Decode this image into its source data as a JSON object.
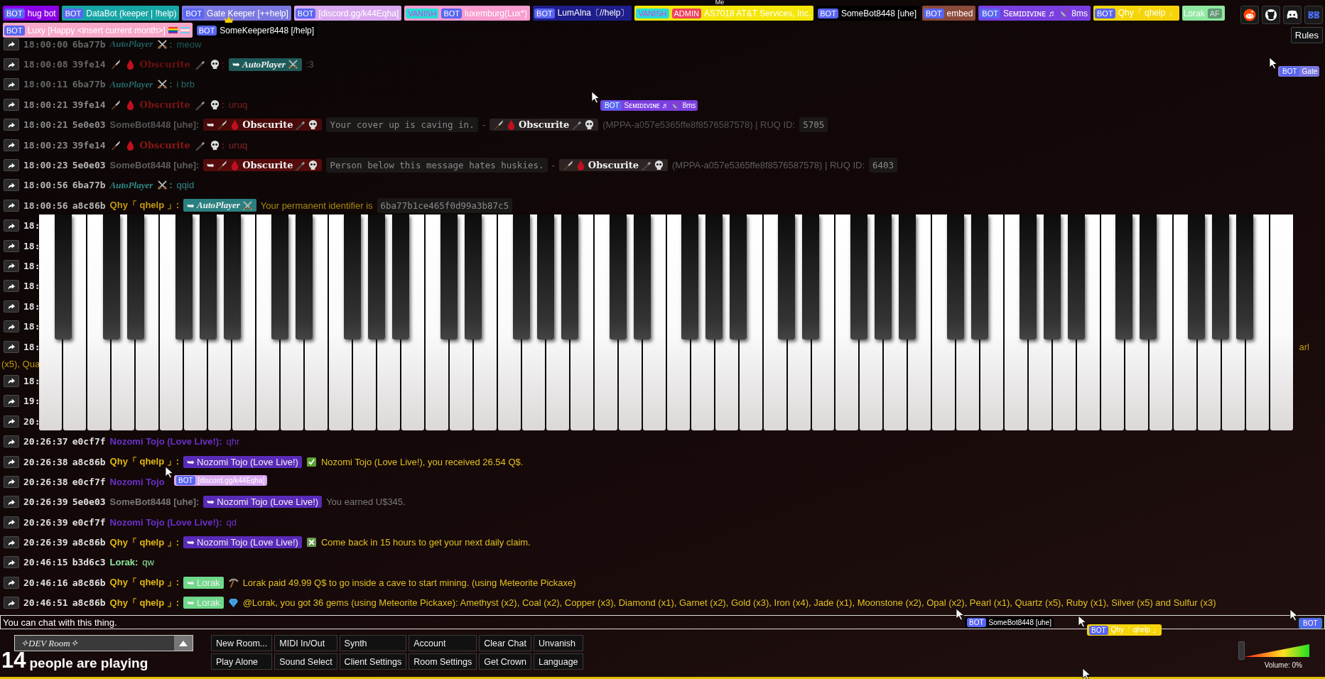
{
  "top_bar": {
    "users": [
      {
        "kind": "plain",
        "labels": [
          {
            "kind": "bot",
            "text": "BOT"
          }
        ],
        "name": "hug bot",
        "color": "#8a00e6"
      },
      {
        "kind": "plain",
        "labels": [
          {
            "kind": "bot",
            "text": "BOT"
          }
        ],
        "name": "DataBot (keeper | !help)",
        "color": "#17a5a5"
      },
      {
        "kind": "plain",
        "labels": [
          {
            "kind": "bot",
            "text": "BOT"
          }
        ],
        "name": "Gate Keeper [++help]",
        "color": "#7a78e0"
      },
      {
        "kind": "plain",
        "labels": [
          {
            "kind": "bot",
            "text": "BOT"
          }
        ],
        "name": "[discord.gg/k44Eqha]",
        "color": "#d9a8f0"
      },
      {
        "kind": "plain",
        "labels": [
          {
            "kind": "vanish",
            "text": "VANISH"
          },
          {
            "kind": "bot",
            "text": "BOT"
          }
        ],
        "name": "luxemburg(Lux*)",
        "color": "#f99ccf"
      },
      {
        "kind": "plain",
        "labels": [
          {
            "kind": "bot",
            "text": "BOT"
          }
        ],
        "name": "LumAlna〔//help〕",
        "color": "#1e1e8c"
      },
      {
        "kind": "plain",
        "labels": [
          {
            "kind": "vanish",
            "text": "VANISH"
          },
          {
            "kind": "admin",
            "text": "ADMIN"
          }
        ],
        "name": "AS7018 AT&T Services, Inc.",
        "color": "#f5e60a",
        "self_label": "Me"
      },
      {
        "kind": "plain",
        "labels": [
          {
            "kind": "bot",
            "text": "BOT"
          }
        ],
        "name": "SomeBot8448 [uhe]",
        "color": "#000000"
      },
      {
        "kind": "plain",
        "labels": [
          {
            "kind": "bot",
            "text": "BOT"
          }
        ],
        "name": "embed",
        "color": "#8b4a3a"
      },
      {
        "kind": "ping",
        "labels": [
          {
            "kind": "bot",
            "text": "BOT"
          }
        ],
        "name": "Sᴇᴍɪᴅɪᴠɪɴᴇ ♬",
        "suffix": "8ms",
        "color": "#7b3fe0"
      },
      {
        "kind": "plain",
        "labels": [
          {
            "kind": "bot",
            "text": "BOT"
          }
        ],
        "name": "Qhy「 qhelp 」",
        "color": "#f5d50a"
      },
      {
        "kind": "plain",
        "name": "Lorak",
        "labels_after": [
          {
            "kind": "afk",
            "text": "AF"
          }
        ],
        "color": "#8ee8a0"
      }
    ],
    "more_users": [
      {
        "kind": "flagged",
        "labels": [
          {
            "kind": "bot",
            "text": "BOT"
          }
        ],
        "name": "Luxy [Happy <insert current month>]",
        "color": "#f7a8c8"
      },
      {
        "kind": "plain",
        "labels": [
          {
            "kind": "bot",
            "text": "BOT"
          }
        ],
        "name": "SomeKeeper8448 [/help]",
        "color": "#000000",
        "owner": true
      }
    ],
    "rules_button": "Rules"
  },
  "chat": [
    {
      "time": "18:00:00",
      "id": "6ba77b",
      "parts": [
        {
          "kind": "script_name",
          "text": "AutoPlayer",
          "color": "#1f5e5e"
        },
        {
          "kind": "punct",
          "text": ":"
        },
        {
          "kind": "text",
          "text": "meow",
          "color": "#1f5e5e"
        }
      ]
    },
    {
      "time": "18:00:08",
      "id": "39fe14",
      "parts": [
        {
          "kind": "gothic_name",
          "text": "Obscurite",
          "color": "#6a1010"
        },
        {
          "kind": "punct",
          "text": ":"
        },
        {
          "kind": "script_tag",
          "arrow": "➥",
          "text": "AutoPlayer",
          "color": "#1e5a5a"
        },
        {
          "kind": "text",
          "text": ":3",
          "color": "#555555"
        }
      ]
    },
    {
      "time": "18:00:11",
      "id": "6ba77b",
      "parts": [
        {
          "kind": "script_name",
          "text": "AutoPlayer",
          "color": "#256b6b"
        },
        {
          "kind": "punct",
          "text": ":"
        },
        {
          "kind": "text",
          "text": "i brb",
          "color": "#256b6b"
        }
      ]
    },
    {
      "time": "18:00:21",
      "id": "39fe14",
      "parts": [
        {
          "kind": "gothic_name",
          "text": "Obscurite",
          "color": "#7a1414"
        },
        {
          "kind": "punct",
          "text": ":"
        },
        {
          "kind": "text",
          "text": "uruq",
          "color": "#7a2020"
        }
      ]
    },
    {
      "time": "18:00:21",
      "id": "5e0e03",
      "parts": [
        {
          "kind": "name",
          "text": "SomeBot8448 [uhe]:",
          "color": "#555555"
        },
        {
          "kind": "gothic_tag",
          "arrow": "➥",
          "text": "Obscurite",
          "color": "#4a0a0a"
        },
        {
          "kind": "code",
          "text": "Your cover up is caving in."
        },
        {
          "kind": "text",
          "text": "-"
        },
        {
          "kind": "gothic_tag",
          "text": "Obscurite",
          "color": "#2a2222"
        },
        {
          "kind": "text",
          "text": "(MPPA-a057e5365ffe8f8576587578) | RUQ ID:",
          "color": "#555555"
        },
        {
          "kind": "code",
          "text": "5705"
        }
      ]
    },
    {
      "time": "18:00:23",
      "id": "39fe14",
      "parts": [
        {
          "kind": "gothic_name",
          "text": "Obscurite",
          "color": "#8a1616"
        },
        {
          "kind": "punct",
          "text": ":"
        },
        {
          "kind": "text",
          "text": "uruq",
          "color": "#8a2424"
        }
      ]
    },
    {
      "time": "18:00:23",
      "id": "5e0e03",
      "parts": [
        {
          "kind": "name",
          "text": "SomeBot8448 [uhe]:",
          "color": "#5e5e5e"
        },
        {
          "kind": "gothic_tag",
          "arrow": "➥",
          "text": "Obscurite",
          "color": "#550b0b"
        },
        {
          "kind": "code",
          "text": "Person below this message hates huskies."
        },
        {
          "kind": "text",
          "text": "-"
        },
        {
          "kind": "gothic_tag",
          "text": "Obscurite",
          "color": "#2e2424"
        },
        {
          "kind": "text",
          "text": "(MPPA-a057e5365ffe8f8576587578) | RUQ ID:",
          "color": "#5e5e5e"
        },
        {
          "kind": "code",
          "text": "6403"
        }
      ]
    },
    {
      "time": "18:00:56",
      "id": "6ba77b",
      "parts": [
        {
          "kind": "script_name",
          "text": "AutoPlayer",
          "color": "#2f8a8a"
        },
        {
          "kind": "punct",
          "text": ":"
        },
        {
          "kind": "text",
          "text": "qqid",
          "color": "#2f8a8a"
        }
      ]
    },
    {
      "time": "18:00:56",
      "id": "a8c86b",
      "parts": [
        {
          "kind": "name",
          "text": "Qhy「 qhelp 」:",
          "color": "#c09a10"
        },
        {
          "kind": "script_tag",
          "arrow": "➥",
          "text": "AutoPlayer",
          "color": "#2a8080"
        },
        {
          "kind": "text",
          "text": "Your permanent identifier is",
          "color": "#a88a10"
        },
        {
          "kind": "code",
          "text": "6ba77b1ce465f0d99a3b87c5"
        }
      ]
    },
    {
      "time": "18:"
    },
    {
      "time": "18:"
    },
    {
      "time": "18:"
    },
    {
      "time": "18:"
    },
    {
      "time": "18:"
    },
    {
      "time": "18:"
    },
    {
      "time": "18:",
      "tail": "arl",
      "continuation": "(x5), Qua"
    },
    {
      "time": "18:"
    },
    {
      "time": "19:"
    },
    {
      "time": "20:"
    },
    {
      "time": "20:26:37",
      "id": "e0cf7f",
      "parts": [
        {
          "kind": "name",
          "text": "Nozomi Tojo (Love Live!):",
          "color": "#6a30c8"
        },
        {
          "kind": "text",
          "text": "qhr",
          "color": "#6a30c8"
        }
      ]
    },
    {
      "time": "20:26:38",
      "id": "a8c86b",
      "parts": [
        {
          "kind": "name",
          "text": "Qhy「 qhelp 」:",
          "color": "#e0b810"
        },
        {
          "kind": "tag",
          "arrow": "➥",
          "text": "Nozomi Tojo (Love Live!)",
          "color": "#5a2ab8"
        },
        {
          "kind": "check"
        },
        {
          "kind": "text",
          "text": "Nozomi Tojo (Love Live!), you received 26.54 Q$.",
          "color": "#e0c020"
        }
      ]
    },
    {
      "time": "20:26:38",
      "id": "e0cf7f",
      "parts": [
        {
          "kind": "name",
          "text": "Nozomi Tojo",
          "color": "#6a30c8"
        }
      ]
    },
    {
      "time": "20:26:39",
      "id": "5e0e03",
      "parts": [
        {
          "kind": "name",
          "text": "SomeBot8448 [uhe]:",
          "color": "#777777"
        },
        {
          "kind": "tag",
          "arrow": "➥",
          "text": "Nozomi Tojo (Love Live!)",
          "color": "#5a2ab8"
        },
        {
          "kind": "text",
          "text": "You earned U$345.",
          "color": "#7a7a7a"
        }
      ]
    },
    {
      "time": "20:26:39",
      "id": "e0cf7f",
      "parts": [
        {
          "kind": "name",
          "text": "Nozomi Tojo (Love Live!):",
          "color": "#6a30c8"
        },
        {
          "kind": "text",
          "text": "qd",
          "color": "#6a30c8"
        }
      ]
    },
    {
      "time": "20:26:39",
      "id": "a8c86b",
      "parts": [
        {
          "kind": "name",
          "text": "Qhy「 qhelp 」:",
          "color": "#e0b810"
        },
        {
          "kind": "tag",
          "arrow": "➥",
          "text": "Nozomi Tojo (Love Live!)",
          "color": "#5a2ab8"
        },
        {
          "kind": "cross"
        },
        {
          "kind": "text",
          "text": "Come back in 15 hours to get your next daily claim.",
          "color": "#e0c020"
        }
      ]
    },
    {
      "time": "20:46:15",
      "id": "b3d6c3",
      "parts": [
        {
          "kind": "name",
          "text": "Lorak:",
          "color": "#8ee8a0"
        },
        {
          "kind": "text",
          "text": "qw",
          "color": "#8ee8a0"
        }
      ]
    },
    {
      "time": "20:46:16",
      "id": "a8c86b",
      "parts": [
        {
          "kind": "name",
          "text": "Qhy「 qhelp 」:",
          "color": "#e0b810"
        },
        {
          "kind": "tag",
          "arrow": "➥",
          "text": "Lorak",
          "color": "#6fd88a"
        },
        {
          "kind": "pickaxe"
        },
        {
          "kind": "text",
          "text": "Lorak paid 49.99 Q$ to go inside a cave to start mining. (using Meteorite Pickaxe)",
          "color": "#e0c020"
        }
      ]
    },
    {
      "time": "20:46:51",
      "id": "a8c86b",
      "parts": [
        {
          "kind": "name",
          "text": "Qhy「 qhelp 」:",
          "color": "#e0b810"
        },
        {
          "kind": "tag",
          "arrow": "➥",
          "text": "Lorak",
          "color": "#6fd88a"
        },
        {
          "kind": "gem"
        },
        {
          "kind": "text",
          "text": "@Lorak, you got 36 gems (using Meteorite Pickaxe): Amethyst (x2), Coal (x2), Copper (x3), Diamond (x1), Garnet (x2), Gold (x3), Iron (x4), Jade (x1), Moonstone (x2), Opal (x2), Pearl (x1), Quartz (x5), Ruby (x1), Silver (x5) and Sulfur (x3)",
          "color": "#e0c020"
        }
      ]
    }
  ],
  "cursors": [
    {
      "kind": "ping",
      "labels": [
        {
          "kind": "bot",
          "text": "BOT"
        }
      ],
      "name": "Sᴇᴍɪᴅɪᴠɪɴᴇ ♬",
      "suffix": "8ms",
      "color": "#7b3fe0"
    },
    {
      "kind": "plain",
      "labels": [
        {
          "kind": "bot",
          "text": "BOT"
        }
      ],
      "name": "Gate",
      "color": "#7a78e0"
    },
    {
      "kind": "plain",
      "labels": [
        {
          "kind": "bot",
          "text": "BOT"
        }
      ],
      "name": "[discord.gg/k44Eqha]",
      "color": "#d9a8f0"
    },
    {
      "kind": "plain",
      "labels": [
        {
          "kind": "bot",
          "text": "BOT"
        }
      ],
      "name": "SomeBot8448 [uhe]",
      "color": "#000000"
    },
    {
      "kind": "plain",
      "labels": [
        {
          "kind": "bot",
          "text": "BOT"
        }
      ],
      "name": "Qhy「 qhelp 」",
      "color": "#f5d50a"
    },
    {
      "kind": "plain",
      "labels": [
        {
          "kind": "bot",
          "text": "BOT"
        }
      ],
      "color": "#3a7ad8"
    }
  ],
  "chat_input": {
    "placeholder": "You can chat with this thing."
  },
  "room_select": {
    "value": "✧DEV Room✧"
  },
  "player_count": "14",
  "player_count_label": "people are playing",
  "buttons": [
    "New Room...",
    "MIDI In/Out",
    "Synth",
    "Account",
    "Clear Chat",
    "Unvanish",
    "Play Alone",
    "Sound Select",
    "Client Settings",
    "Room Settings",
    "Get Crown",
    "Language"
  ],
  "volume": {
    "level": 0,
    "reading": "Volume: 0%"
  }
}
